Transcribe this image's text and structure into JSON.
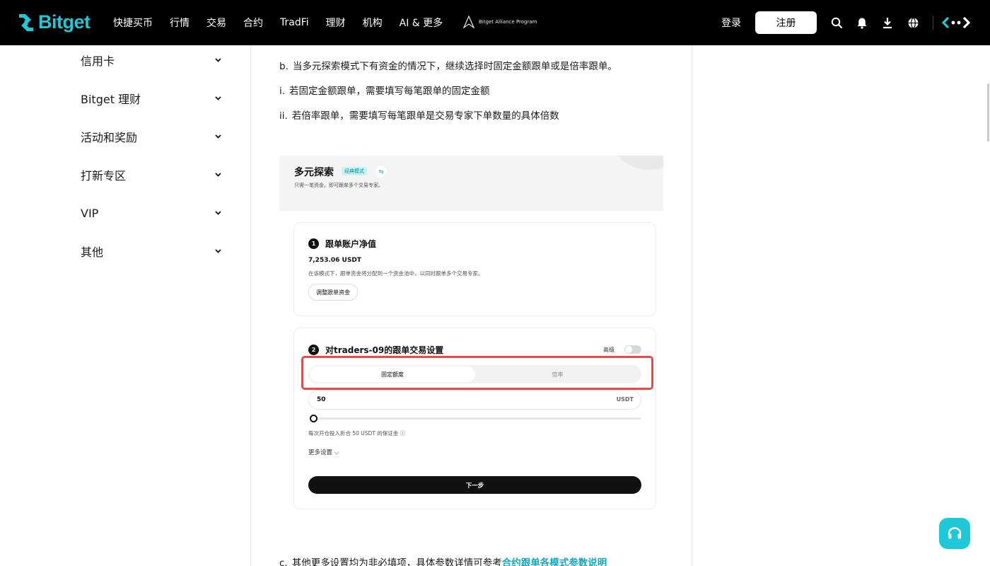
{
  "header": {
    "brand": "Bitget",
    "nav": [
      "快捷买币",
      "行情",
      "交易",
      "合约",
      "TradFi",
      "理财",
      "机构",
      "AI & 更多"
    ],
    "alliance_label": "Bitget Alliance Program",
    "login_label": "登录",
    "register_label": "注册",
    "icons": [
      "search-icon",
      "bell-icon",
      "download-icon",
      "globe-icon",
      "theme-icon"
    ],
    "brand_color": "#1ec8d6"
  },
  "sidebar": {
    "items": [
      {
        "label": "信用卡"
      },
      {
        "label": "Bitget 理财"
      },
      {
        "label": "活动和奖励"
      },
      {
        "label": "打新专区"
      },
      {
        "label": "VIP"
      },
      {
        "label": "其他"
      }
    ]
  },
  "article": {
    "para_b": {
      "marker": "b.",
      "text": "当多元探索模式下有资金的情况下，继续选择时固定金额跟单或是倍率跟单。"
    },
    "para_i": {
      "marker": "i.",
      "text": "若固定金额跟单，需要填写每笔跟单的固定金额"
    },
    "para_ii": {
      "marker": "ii.",
      "text": "若倍率跟单，需要填写每笔跟单是交易专家下单数量的具体倍数"
    },
    "para_c": {
      "marker": "c.",
      "text": "其他更多设置均为非必填项，具体参数详情可参考",
      "link": "合约跟单各模式参数说明"
    }
  },
  "screenshot": {
    "title": "多元探索",
    "badge": "经典模式",
    "subtitle": "只需一笔资金，即可跟单多个交易专家。",
    "step1": {
      "num": "1",
      "title": "跟单账户净值",
      "value": "7,253.06 USDT",
      "desc": "在该模式下，跟单资金将分配到一个资金池中，以同时跟单多个交易专家。",
      "button": "调整跟单资金"
    },
    "step2": {
      "num": "2",
      "title": "对traders-09的跟单交易设置",
      "advanced": "高级",
      "tab_active": "固定额度",
      "tab_other": "倍率",
      "amount": "50",
      "unit": "USDT",
      "margin_note": "每次开仓投入折合 50 USDT 的保证金 ⓘ",
      "more": "更多设置 ⌵",
      "next": "下一步"
    },
    "highlight_color": "#e84a4a"
  }
}
